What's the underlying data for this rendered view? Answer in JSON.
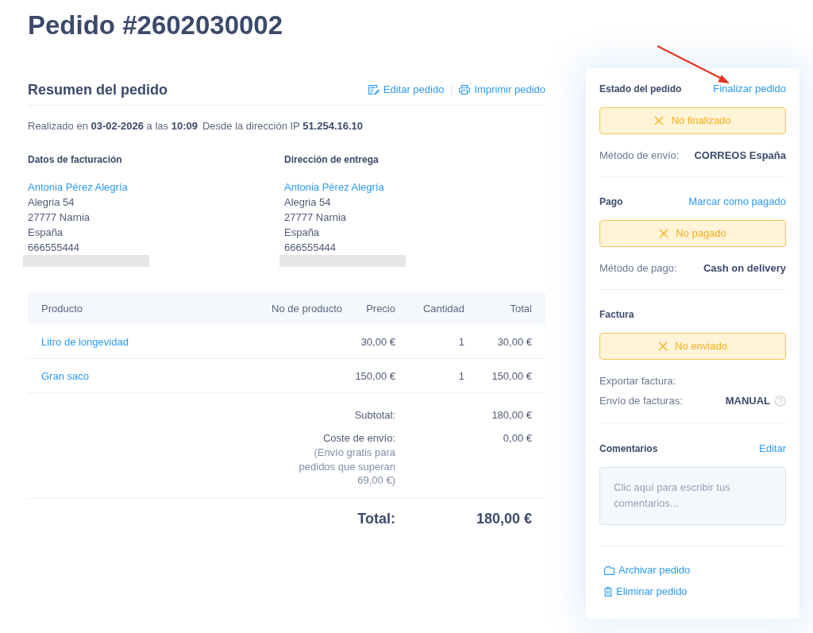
{
  "page": {
    "title": "Pedido #2602030002"
  },
  "summary": {
    "title": "Resumen del pedido",
    "actions": [
      {
        "kind": "edit",
        "label": "Editar pedido"
      },
      {
        "kind": "print",
        "label": "Imprimir pedido"
      }
    ],
    "placed": "Realizado en **03-02-2026** a las **10:09**",
    "ip": "Desde la dirección IP **51.254.16.10**",
    "addresses": [
      {
        "heading": "Datos de facturación",
        "name": "Antonia Pérez Alegría",
        "lines": [
          "Alegria 54",
          "27777 Narnia",
          "España",
          "666555444"
        ],
        "redacted": true
      },
      {
        "heading": "Dirección de entrega",
        "name": "Antonia Pérez Alegría",
        "lines": [
          "Alegria 54",
          "27777 Narnia",
          "España",
          "666555444"
        ],
        "redacted": true
      }
    ]
  },
  "table": {
    "columns": [
      "Producto",
      "No de producto",
      "Precio",
      "Cantidad",
      "Total"
    ],
    "rows": [
      {
        "product": "Litro de longevidad",
        "price": "30,00 €",
        "quantity": "1",
        "total": "30,00 €"
      },
      {
        "product": "Gran saco",
        "price": "150,00 €",
        "quantity": "1",
        "total": "150,00 €"
      }
    ]
  },
  "totals": {
    "subtotal": {
      "label": "Subtotal:",
      "value": "180,00 €"
    },
    "shipping": {
      "label": "Coste de envío:",
      "note": "(Envío gratis para pedidos que superan 69,00 €)",
      "value": "0,00 €"
    },
    "total": {
      "label": "Total:",
      "value": "180,00 €"
    }
  },
  "sidebar": {
    "sections": [
      {
        "kind": "status",
        "heading": "Estado del pedido",
        "action": "Finalizar pedido",
        "badge": {
          "label": "No finalizado",
          "completed": false
        },
        "details": [
          {
            "label": "Método de envío:",
            "value": "CORREOS España"
          }
        ]
      },
      {
        "kind": "status",
        "heading": "Pago",
        "action": "Marcar como pagado",
        "badge": {
          "label": "No pagado",
          "completed": false
        },
        "details": [
          {
            "label": "Método de pago:",
            "value": "Cash on delivery"
          }
        ]
      },
      {
        "kind": "status",
        "heading": "Factura",
        "badge": {
          "label": "No enviado",
          "completed": false
        },
        "details": [
          {
            "label": "Exportar factura:"
          },
          {
            "label": "Envío de facturas:",
            "value": "MANUAL",
            "help": true
          }
        ]
      },
      {
        "kind": "comments",
        "heading": "Comentarios",
        "action": "Editar",
        "placeholder": "Clic aquí para escribir tus comentarios..."
      },
      {
        "kind": "links",
        "links": [
          {
            "kind": "archive",
            "label": "Archivar pedido"
          },
          {
            "kind": "delete",
            "label": "Eliminar pedido"
          }
        ]
      }
    ]
  }
}
